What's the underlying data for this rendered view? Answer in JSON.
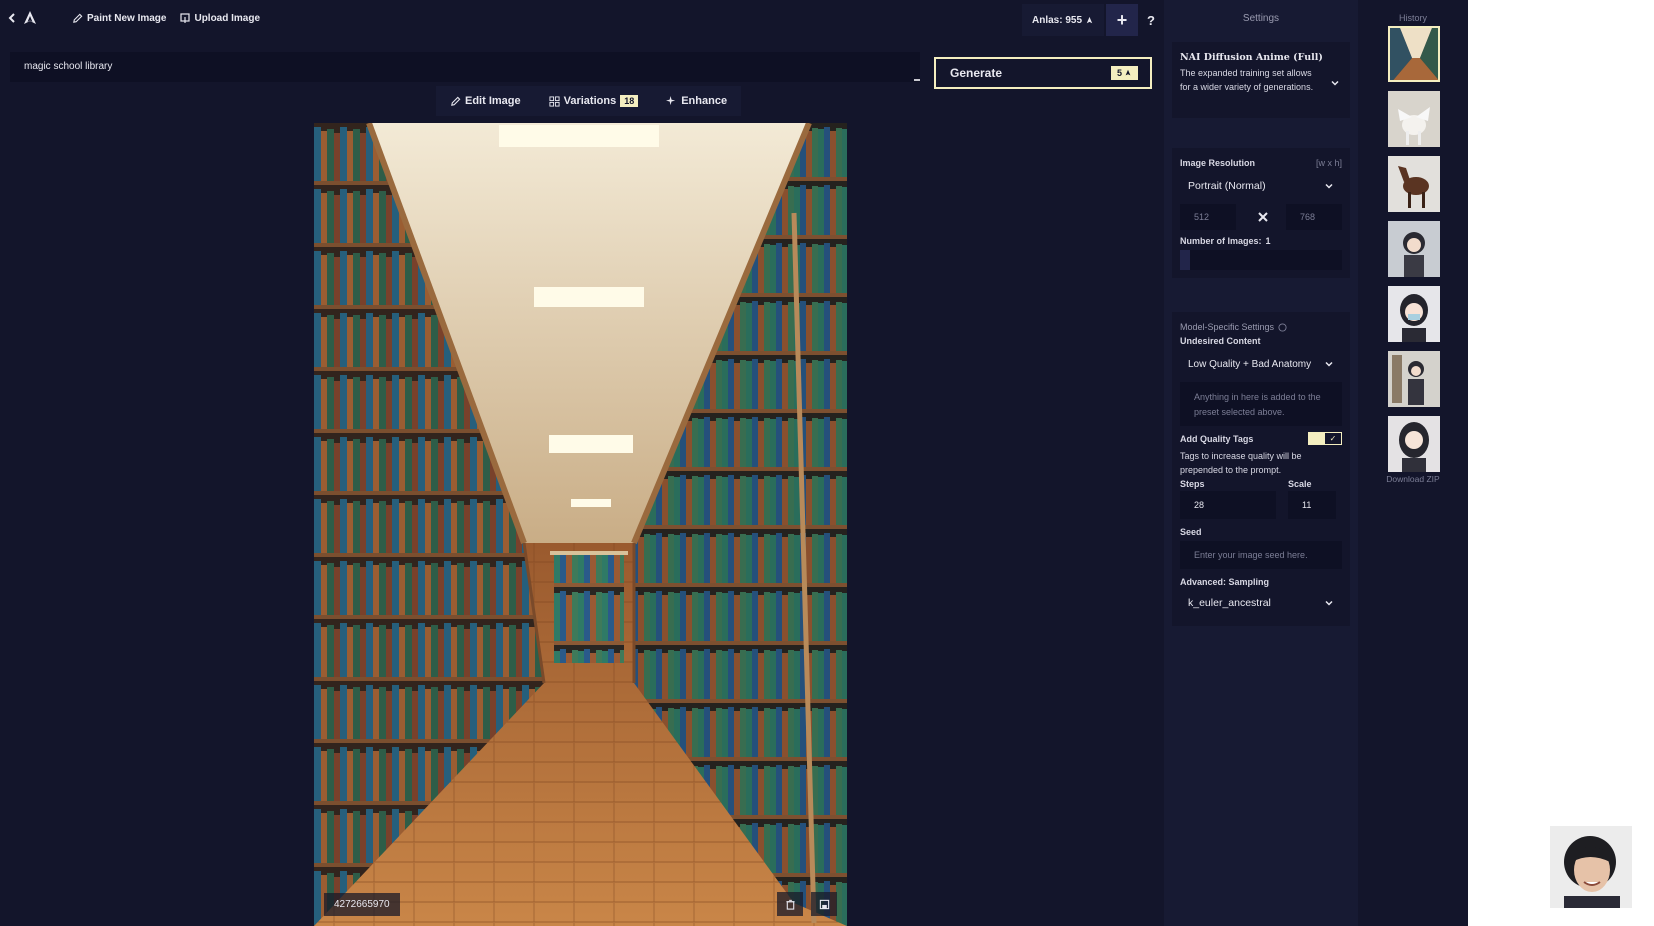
{
  "topbar": {
    "paint_new_image": "Paint New Image",
    "upload_image": "Upload Image",
    "anlas": "Anlas: 955",
    "plus": "+",
    "help": "?"
  },
  "prompt": {
    "value": "magic school library"
  },
  "generate": {
    "label": "Generate",
    "cost": "5"
  },
  "tools": {
    "edit_image": "Edit Image",
    "variations": "Variations",
    "variations_cost": "18",
    "enhance": "Enhance"
  },
  "image": {
    "seed": "4272665970"
  },
  "settings": {
    "title": "Settings",
    "model": {
      "name": "NAI Diffusion Anime (Full)",
      "description": "The expanded training set allows for a wider variety of generations."
    },
    "resolution": {
      "label": "Image Resolution",
      "hint": "[w x h]",
      "preset": "Portrait (Normal)",
      "width": "512",
      "height": "768"
    },
    "num_images": {
      "label": "Number of Images:",
      "value": "1",
      "fraction": 0
    },
    "model_specific": {
      "label": "Model-Specific Settings",
      "undesired_label": "Undesired Content",
      "undesired_preset": "Low Quality + Bad Anatomy",
      "undesired_placeholder": "Anything in here is added to the preset selected above.",
      "quality_tags_label": "Add Quality Tags",
      "quality_tags_on": true,
      "quality_tags_desc": "Tags to increase quality will be prepended to the prompt.",
      "steps_label": "Steps",
      "steps": "28",
      "scale_label": "Scale",
      "scale": "11",
      "seed_label": "Seed",
      "seed_placeholder": "Enter your image seed here.",
      "sampling_label": "Advanced: Sampling",
      "sampler": "k_euler_ancestral"
    }
  },
  "history": {
    "title": "History",
    "download_zip": "Download ZIP",
    "thumbnails": [
      "library",
      "pegasus",
      "horse",
      "girl-1",
      "girl-2",
      "girl-3",
      "girl-4"
    ]
  },
  "colors": {
    "background": "#13152b",
    "panel": "#171a33",
    "input": "#0e1024",
    "accent": "#f4eec0",
    "text": "#e8e8f0"
  }
}
